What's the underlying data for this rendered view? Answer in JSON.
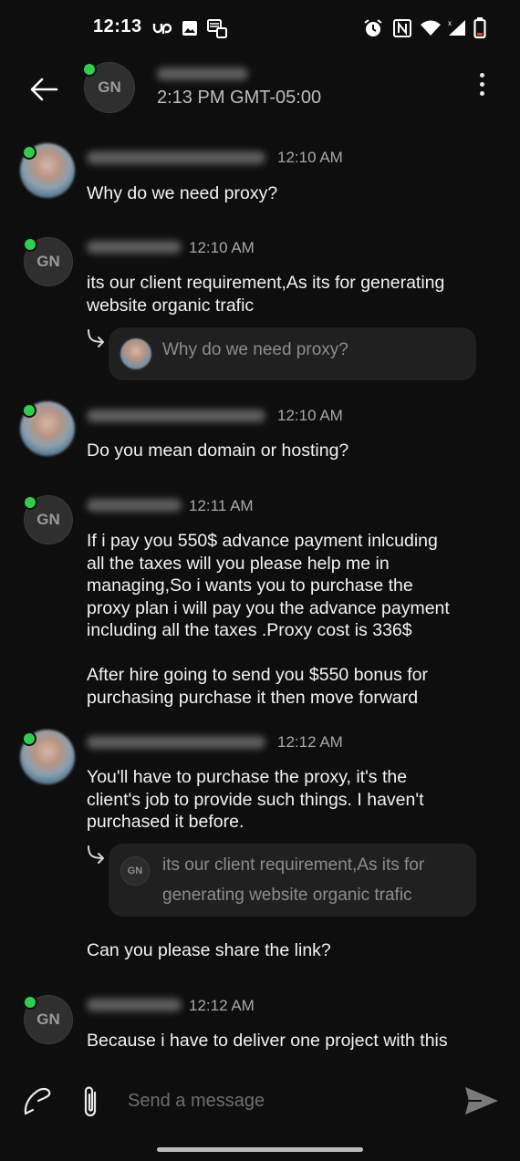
{
  "status_bar": {
    "time": "12:13",
    "left_icons": [
      "upwork-icon",
      "image-icon",
      "screenshot-icon"
    ],
    "right_icons": [
      "alarm-icon",
      "nfc-icon",
      "wifi-icon",
      "signal-icon",
      "battery-icon"
    ]
  },
  "header": {
    "avatar_initials": "GN",
    "subtitle": "2:13 PM GMT-05:00",
    "online": true
  },
  "messages": [
    {
      "sender": "self",
      "time": "12:10 AM",
      "lines": [
        "Why do we need proxy?"
      ]
    },
    {
      "sender": "client",
      "avatar_initials": "GN",
      "time": "12:10 AM",
      "lines": [
        "its our client requirement,As its for generating",
        "website organic trafic"
      ],
      "quote": {
        "lines": [
          "Why do we need proxy?"
        ]
      }
    },
    {
      "sender": "self",
      "time": "12:10 AM",
      "lines": [
        "Do you mean domain or hosting?"
      ]
    },
    {
      "sender": "client",
      "avatar_initials": "GN",
      "time": "12:11 AM",
      "lines": [
        "If i pay you 550$ advance payment inlcuding",
        "all the taxes will you please help me in",
        "managing,So i wants you to purchase the",
        "proxy plan i will pay you the advance payment",
        "including all the taxes .Proxy cost is 336$",
        "After hire going to send you $550 bonus for",
        "purchasing purchase it then move forward"
      ]
    },
    {
      "sender": "self",
      "time": "12:12 AM",
      "lines": [
        "You'll have to purchase the proxy, it's the",
        "client's job to provide such things. I haven't",
        "purchased it before."
      ],
      "quote": {
        "avatar_initials": "GN",
        "lines": [
          "its our client requirement,As its for",
          "generating website organic trafic"
        ]
      },
      "followup": "Can you please share the link?"
    },
    {
      "sender": "client",
      "avatar_initials": "GN",
      "time": "12:12 AM",
      "lines": [
        "Because i have to deliver one project with this"
      ]
    }
  ],
  "composer": {
    "placeholder": "Send a message",
    "icons": [
      "signature-icon",
      "paperclip-icon",
      "send-icon"
    ]
  },
  "colors": {
    "background": "#0e0e0e",
    "online": "#2fcf4b",
    "quote_bg": "#202020",
    "timestamp": "#a8a8a8"
  }
}
